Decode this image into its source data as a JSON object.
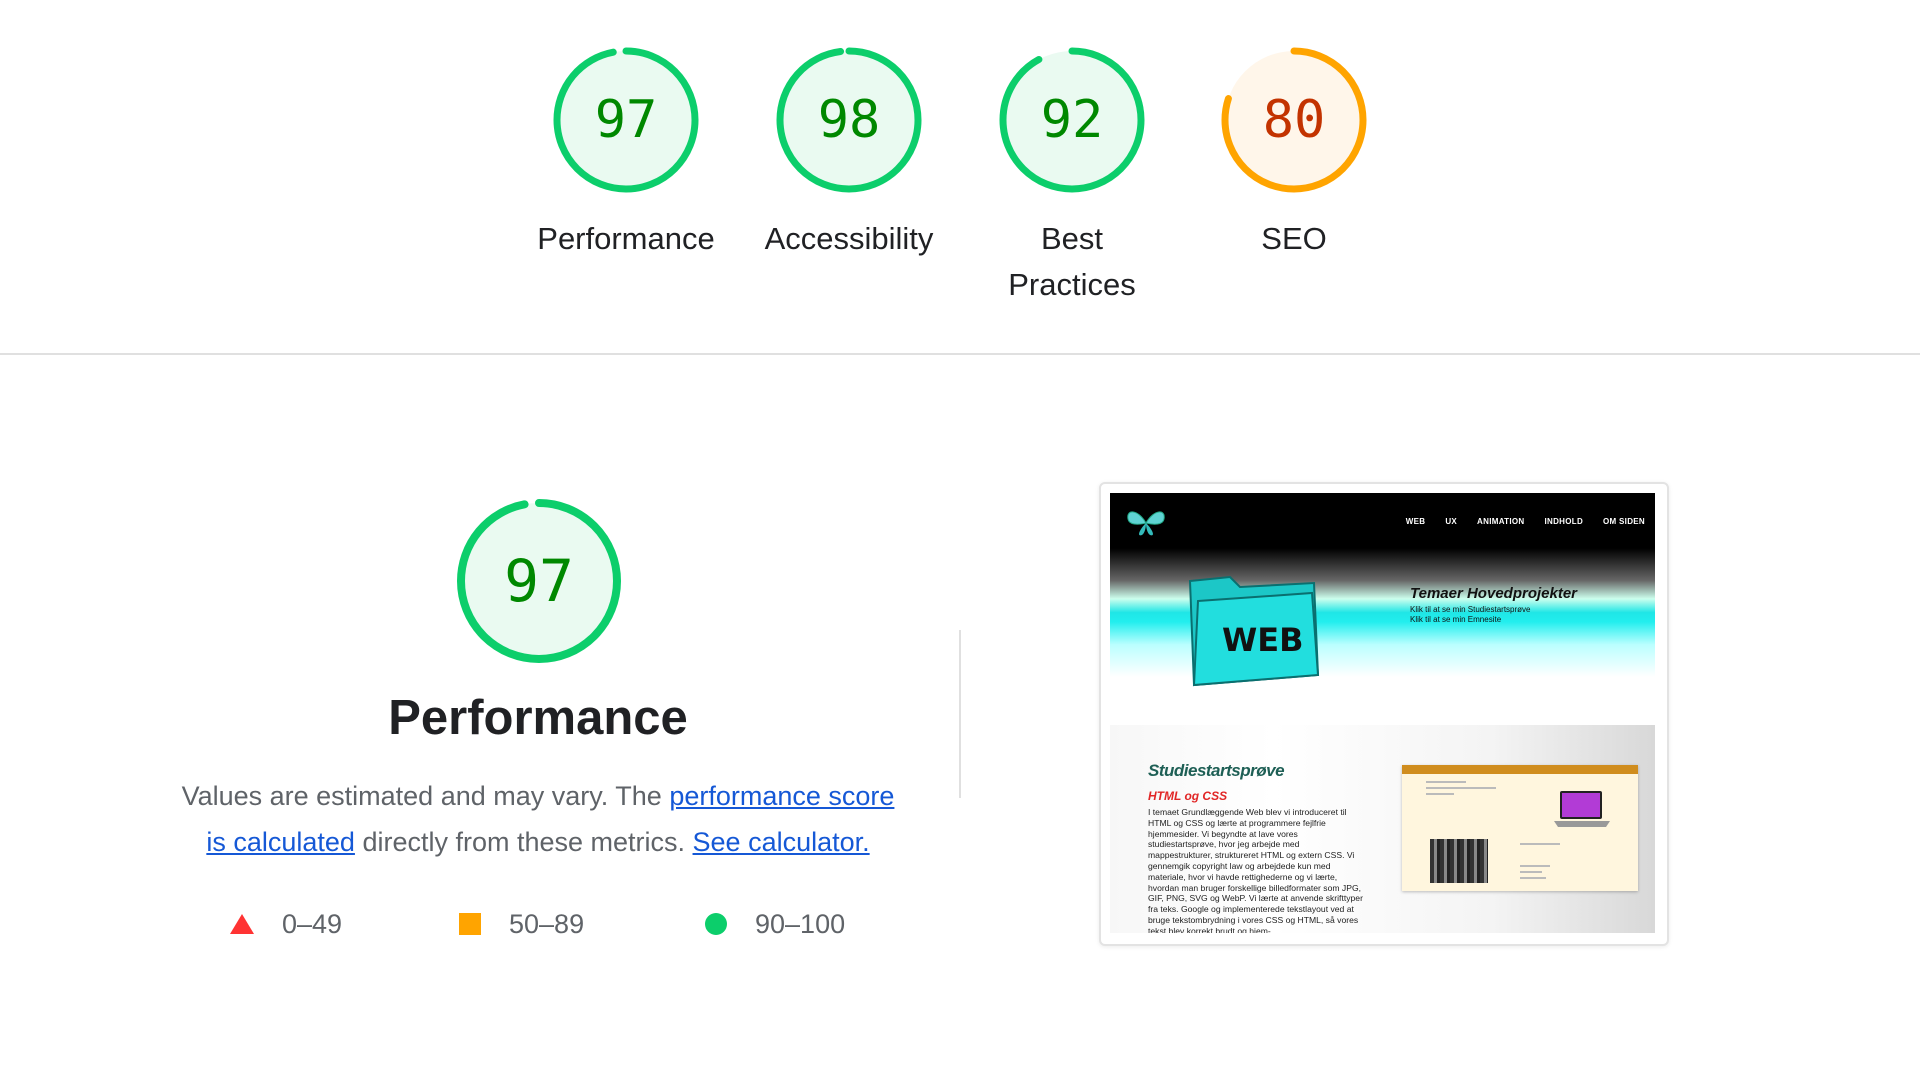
{
  "colors": {
    "pass": "#0cce6b",
    "pass_text": "#008800",
    "pass_fill": "#eafaf1",
    "average": "#ffa400",
    "average_text": "#c33300",
    "average_fill": "#fff6ea",
    "fail": "#ff3333",
    "link": "#1558d6"
  },
  "categories": [
    {
      "label": "Performance",
      "score": 97
    },
    {
      "label": "Accessibility",
      "score": 98
    },
    {
      "label": "Best",
      "label2": "Practices",
      "score": 92
    },
    {
      "label": "SEO",
      "score": 80
    }
  ],
  "performance": {
    "score": 97,
    "title": "Performance",
    "desc_prefix": "Values are estimated and may vary. The ",
    "link1": "performance score",
    "link1b": "is calculated",
    "desc_middle": " directly from these metrics. ",
    "link2": "See calculator."
  },
  "legend": [
    {
      "range": "0–49",
      "icon": "triangle-fail-icon"
    },
    {
      "range": "50–89",
      "icon": "square-average-icon"
    },
    {
      "range": "90–100",
      "icon": "circle-pass-icon"
    }
  ],
  "screenshot": {
    "nav": [
      "WEB",
      "UX",
      "ANIMATION",
      "INDHOLD",
      "OM SIDEN"
    ],
    "folder_label": "WEB",
    "hero_title": "Temaer Hovedprojekter",
    "hero_line1": "Klik til at se min Studiestartsprøve",
    "hero_line2": "Klik til at se min Emnesite",
    "section_title": "Studiestartsprøve",
    "subsection": "HTML og CSS",
    "body": "I temaet Grundlæggende Web blev vi introduceret til HTML og CSS og lærte at programmere fejlfrie hjemmesider. Vi begyndte at lave vores studiestartsprøve, hvor jeg arbejde med mappestrukturer, struktureret HTML og extern CSS. Vi gennemgik copyright law og arbejdede kun med materiale, hvor vi havde rettighederne og vi lærte, hvordan man bruger forskellige billedformater som JPG, GIF, PNG, SVG og WebP. Vi lærte at anvende skrifttyper fra teks. Google og implementerede tekstlayout ved at bruge tekstombrydning i vores CSS og HTML, så vores tekst blev korrekt brudt og hjem-"
  }
}
